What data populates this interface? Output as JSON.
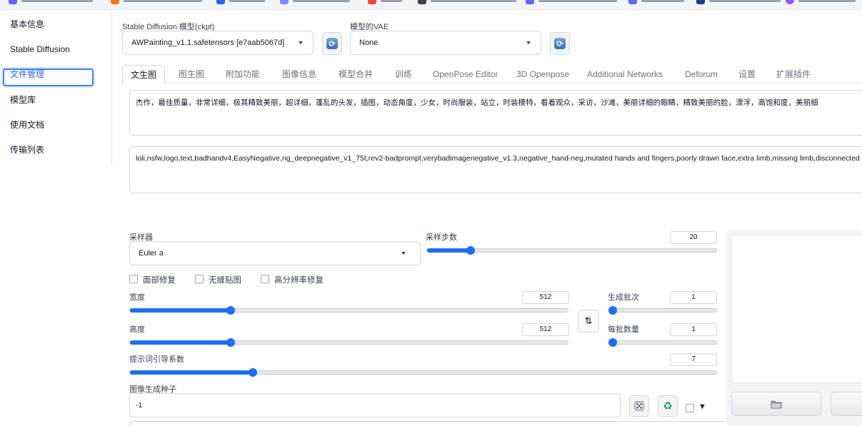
{
  "colors": {
    "accent": "#1d6ef0",
    "active_text": "#2563eb"
  },
  "sidebar": {
    "items": [
      {
        "label": "基本信息"
      },
      {
        "label": "Stable Diffusion"
      },
      {
        "label": "文件管理"
      },
      {
        "label": "模型库"
      },
      {
        "label": "使用文档"
      },
      {
        "label": "传输列表"
      }
    ]
  },
  "models": {
    "ckpt_label": "Stable Diffusion 模型(ckpt)",
    "ckpt_value": "AWPainting_v1.1.safetensors [e7aab5067d]",
    "vae_label": "模型的VAE",
    "vae_value": "None"
  },
  "tabs": [
    {
      "label": "文生图"
    },
    {
      "label": "图生图"
    },
    {
      "label": "附加功能"
    },
    {
      "label": "图像信息"
    },
    {
      "label": "模型合并"
    },
    {
      "label": "训练"
    },
    {
      "label": "OpenPose Editor"
    },
    {
      "label": "3D Openpose"
    },
    {
      "label": "Additional Networks"
    },
    {
      "label": "Deforum"
    },
    {
      "label": "设置"
    },
    {
      "label": "扩展插件"
    }
  ],
  "prompt": {
    "positive": "杰作，最佳质量，非常详细，极其精致美丽，超详细，蓬乱的头发，插图，动态角度，少女，时尚服装，站立，时装模特，看着观众，采访，沙滩，美丽详细的眼睛，精致美丽的脸，漂浮，高饱和度，美丽细",
    "negative": "loli,nsfw,logo,text,badhandv4,EasyNegative,ng_deepnegative_v1_75t,rev2-badprompt,verybadimagenegative_v1.3,negative_hand-neg,mutated hands and fingers,poorly drawn face,extra limb,missing limb,disconnected"
  },
  "sampler": {
    "label": "采样器",
    "value": "Euler a",
    "steps_label": "采样步数",
    "steps_value": "20",
    "steps_fraction": 0.15
  },
  "checkboxes": [
    {
      "label": "面部修复"
    },
    {
      "label": "无缝贴图"
    },
    {
      "label": "高分辨率修复"
    }
  ],
  "size": {
    "width_label": "宽度",
    "width_value": "512",
    "width_fraction": 0.23,
    "height_label": "高度",
    "height_value": "512",
    "height_fraction": 0.23,
    "swap_icon": "swap-icon"
  },
  "batch": {
    "count_label": "生成批次",
    "count_value": "1",
    "count_fraction": 0.0,
    "size_label": "每批数量",
    "size_value": "1",
    "size_fraction": 0.0
  },
  "cfg": {
    "label": "提示词引导系数",
    "value": "7",
    "fraction": 0.21
  },
  "seed": {
    "label": "图像生成种子",
    "value": "-1",
    "extra_glyph": "▼"
  }
}
